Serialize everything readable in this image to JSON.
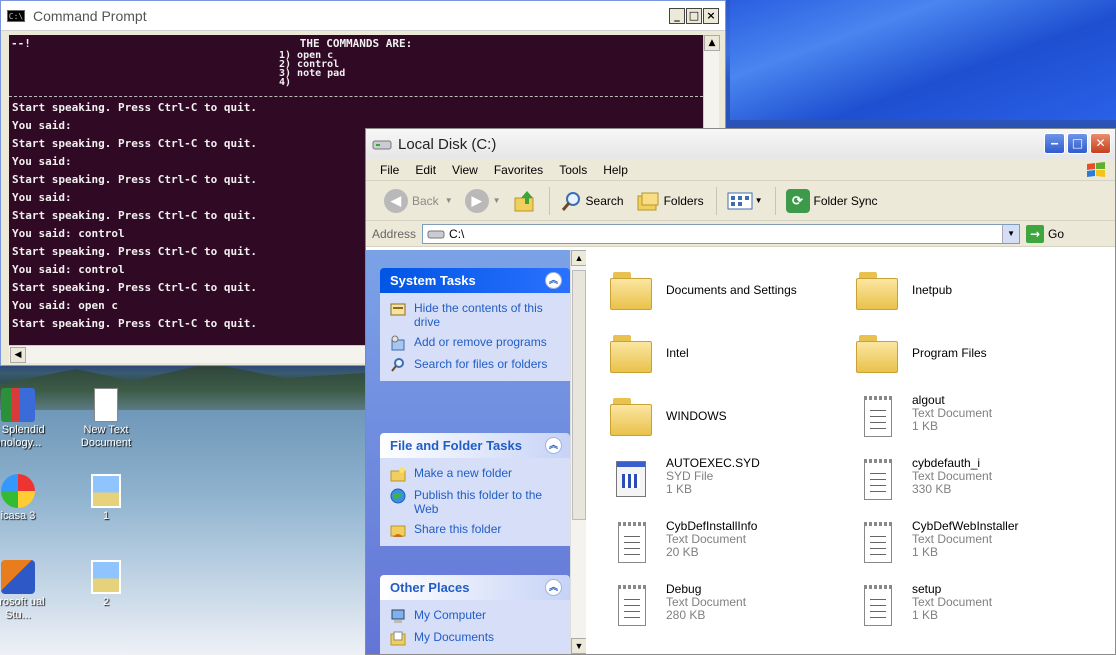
{
  "cmd": {
    "title": "Command Prompt",
    "banner_corner": "--!",
    "banner_heading": "THE COMMANDS ARE:",
    "commands": [
      "1)  open c",
      "2)  control",
      "3)  note pad",
      "4)"
    ],
    "output_lines": [
      "Start speaking. Press Ctrl-C to quit.",
      "You said:",
      "Start speaking. Press Ctrl-C to quit.",
      "You said:",
      "Start speaking. Press Ctrl-C to quit.",
      "You said:",
      "Start speaking. Press Ctrl-C to quit.",
      "You said: control",
      "Start speaking. Press Ctrl-C to quit.",
      "You said: control",
      "Start speaking. Press Ctrl-C to quit.",
      "You said: open c",
      "Start speaking. Press Ctrl-C to quit."
    ],
    "buttons": {
      "minimize": "_",
      "maximize": "□",
      "close": "×"
    }
  },
  "desktop": {
    "icons": [
      {
        "label": "S Splendid nnology...",
        "icon": "splendid-icon"
      },
      {
        "label": "New Text Document",
        "icon": "text-document-icon"
      },
      {
        "label": "icasa 3",
        "icon": "picasa-icon"
      },
      {
        "label": "1",
        "icon": "image-icon"
      },
      {
        "label": "icrosoft ual Stu...",
        "icon": "visual-studio-icon"
      },
      {
        "label": "2",
        "icon": "image-icon"
      }
    ]
  },
  "explorer": {
    "title": "Local Disk (C:)",
    "menu": [
      "File",
      "Edit",
      "View",
      "Favorites",
      "Tools",
      "Help"
    ],
    "toolbar": {
      "back": "Back",
      "search": "Search",
      "folders": "Folders",
      "folder_sync": "Folder Sync"
    },
    "address": {
      "label": "Address",
      "value": "C:\\",
      "go": "Go"
    },
    "panels": {
      "system_tasks": {
        "title": "System Tasks",
        "items": [
          "Hide the contents of this drive",
          "Add or remove programs",
          "Search for files or folders"
        ]
      },
      "file_folder_tasks": {
        "title": "File and Folder Tasks",
        "items": [
          "Make a new folder",
          "Publish this folder to the Web",
          "Share this folder"
        ]
      },
      "other_places": {
        "title": "Other Places",
        "items": [
          "My Computer",
          "My Documents"
        ]
      }
    },
    "files": [
      {
        "name": "Documents and Settings",
        "type": "",
        "size": "",
        "kind": "folder"
      },
      {
        "name": "Inetpub",
        "type": "",
        "size": "",
        "kind": "folder"
      },
      {
        "name": "Intel",
        "type": "",
        "size": "",
        "kind": "folder"
      },
      {
        "name": "Program Files",
        "type": "",
        "size": "",
        "kind": "folder"
      },
      {
        "name": "WINDOWS",
        "type": "",
        "size": "",
        "kind": "folder"
      },
      {
        "name": "algout",
        "type": "Text Document",
        "size": "1 KB",
        "kind": "text"
      },
      {
        "name": "AUTOEXEC.SYD",
        "type": "SYD File",
        "size": "1 KB",
        "kind": "syd"
      },
      {
        "name": "cybdefauth_i",
        "type": "Text Document",
        "size": "330 KB",
        "kind": "text"
      },
      {
        "name": "CybDefInstallInfo",
        "type": "Text Document",
        "size": "20 KB",
        "kind": "text"
      },
      {
        "name": "CybDefWebInstaller",
        "type": "Text Document",
        "size": "1 KB",
        "kind": "text"
      },
      {
        "name": "Debug",
        "type": "Text Document",
        "size": "280 KB",
        "kind": "text"
      },
      {
        "name": "setup",
        "type": "Text Document",
        "size": "1 KB",
        "kind": "text"
      }
    ]
  }
}
